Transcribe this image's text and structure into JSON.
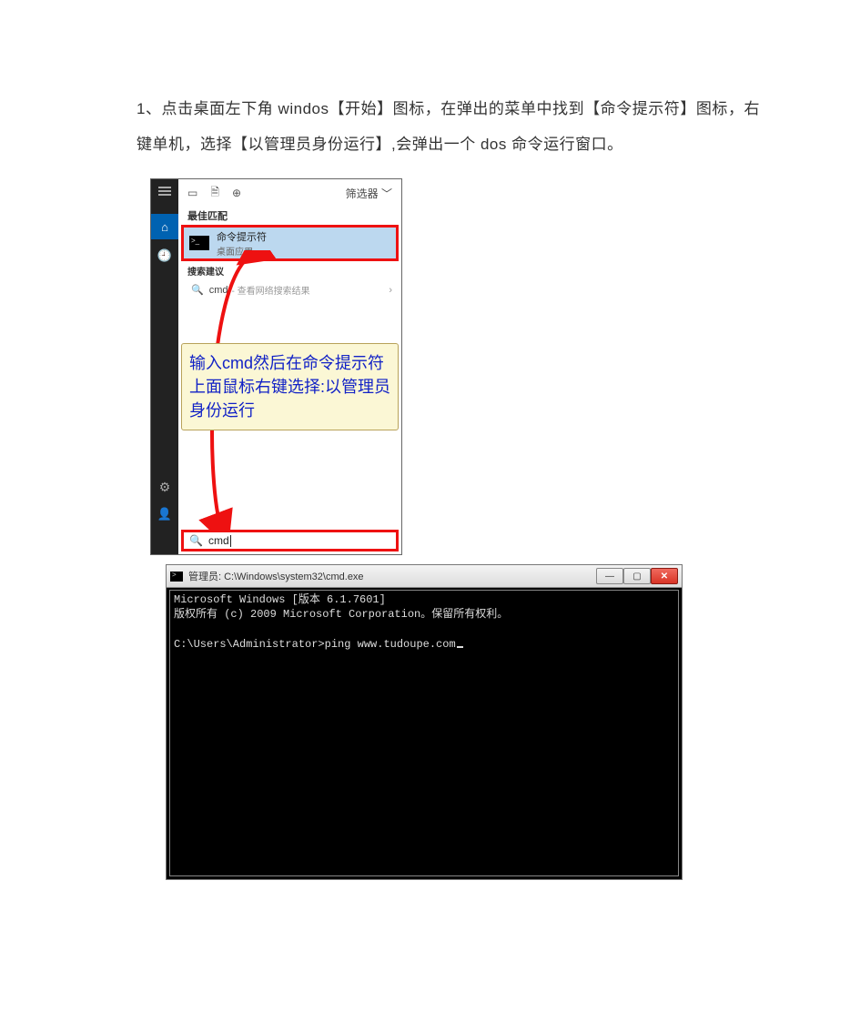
{
  "instruction": "1、点击桌面左下角 windos【开始】图标，在弹出的菜单中找到【命令提示符】图标，右键单机，选择【以管理员身份运行】,会弹出一个 dos 命令运行窗口。",
  "fig1": {
    "filter_label": "筛选器",
    "section_best": "最佳匹配",
    "match_title": "命令提示符",
    "match_sub": "桌面应用",
    "section_sug": "搜索建议",
    "sug_text": "cmd",
    "sug_hint": "- 查看网络搜索结果",
    "callout": "输入cmd然后在命令提示符上面鼠标右键选择:以管理员身份运行",
    "search_text": "cmd"
  },
  "fig2": {
    "title": "管理员: C:\\Windows\\system32\\cmd.exe",
    "line1": "Microsoft Windows [版本 6.1.7601]",
    "line2": "版权所有 (c) 2009 Microsoft Corporation。保留所有权利。",
    "prompt": "C:\\Users\\Administrator>",
    "typed": "ping www.tudoupe.com"
  }
}
